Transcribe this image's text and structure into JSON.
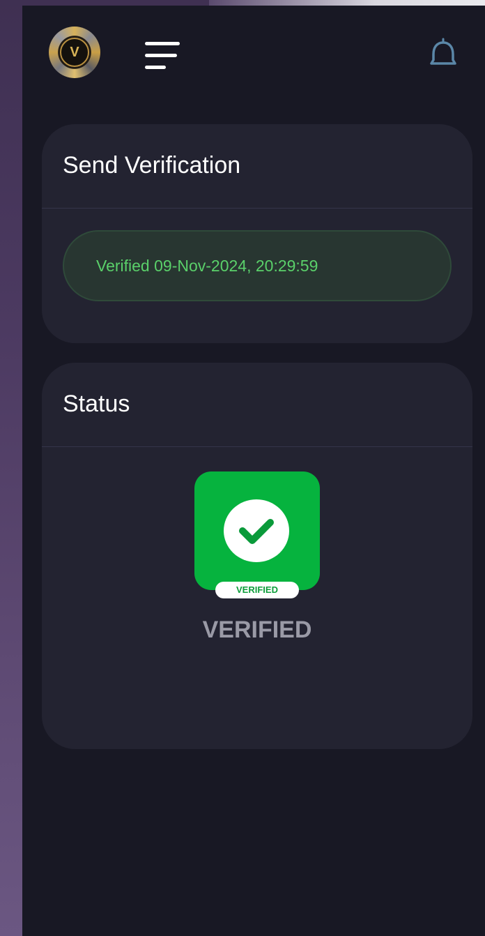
{
  "header": {
    "logo_letter": "V",
    "menu_icon": "hamburger-menu-icon",
    "notification_icon": "bell-icon"
  },
  "send_verification": {
    "title": "Send Verification",
    "verified_message": "Verified 09-Nov-2024, 20:29:59"
  },
  "status": {
    "title": "Status",
    "badge_icon": "check-circle-icon",
    "badge_label": "VERIFIED",
    "status_text": "VERIFIED"
  },
  "colors": {
    "background": "#181824",
    "card": "#232331",
    "verified_green": "#06b33e",
    "verified_text": "#5ad06a",
    "bell": "#5b87a8"
  }
}
